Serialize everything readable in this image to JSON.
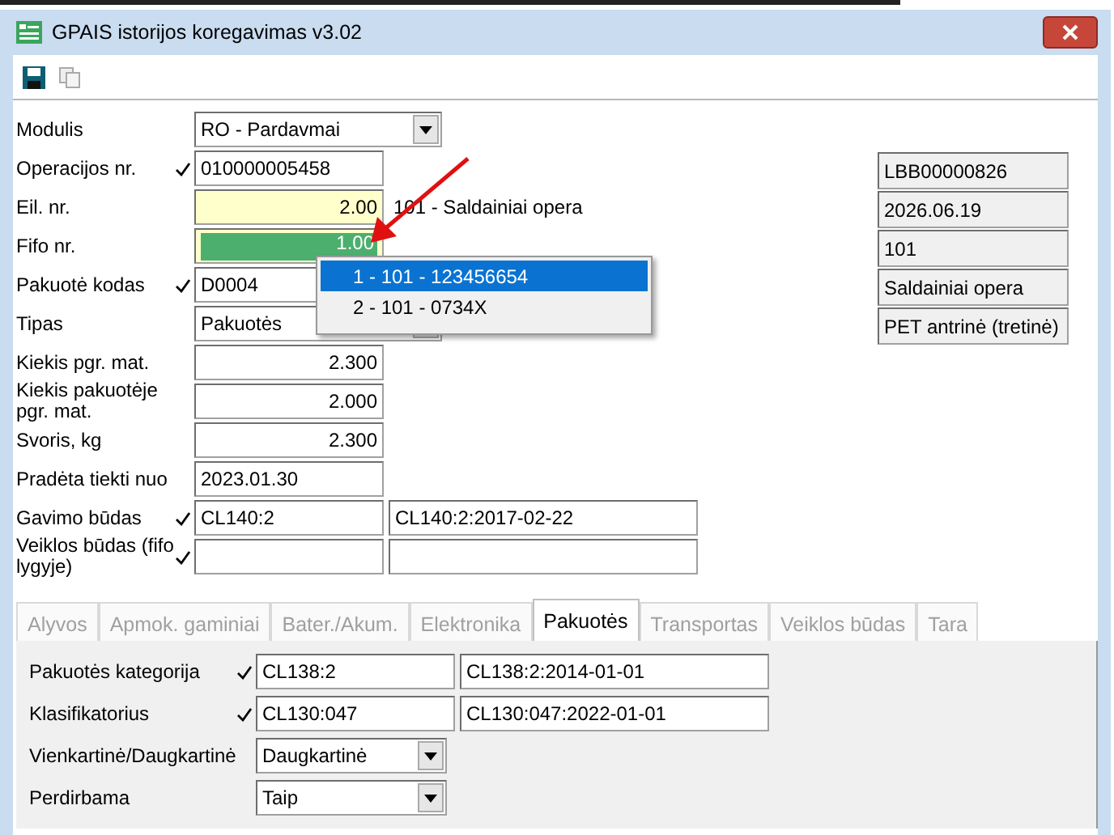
{
  "window": {
    "title": "GPAIS istorijos koregavimas v3.02"
  },
  "form": [
    {
      "label": "Modulis",
      "kind": "select",
      "checked": false,
      "value": "RO - Pardavmai"
    },
    {
      "label": "Operacijos nr.",
      "kind": "text",
      "checked": true,
      "value": "010000005458"
    },
    {
      "label": "Eil. nr.",
      "kind": "number",
      "checked": false,
      "value": "2.00",
      "highlighted": true,
      "note": "101 - Saldainiai opera"
    },
    {
      "label": "Fifo nr.",
      "kind": "number",
      "checked": false,
      "value": "1.00",
      "highlighted": true,
      "value_selected": true
    },
    {
      "label": "Pakuotė kodas",
      "kind": "text",
      "checked": true,
      "value": "D0004"
    },
    {
      "label": "Tipas",
      "kind": "select",
      "checked": false,
      "value": "Pakuotės"
    },
    {
      "label": "Kiekis pgr. mat.",
      "kind": "number",
      "checked": false,
      "value": "2.300"
    },
    {
      "label": "Kiekis pakuotėje pgr. mat.",
      "kind": "number",
      "checked": false,
      "value": "2.000"
    },
    {
      "label": "Svoris, kg",
      "kind": "number",
      "checked": false,
      "value": "2.300"
    },
    {
      "label": "Pradėta tiekti nuo",
      "kind": "text",
      "checked": false,
      "value": "2023.01.30"
    },
    {
      "label": "Gavimo būdas",
      "kind": "pair",
      "checked": true,
      "value": "CL140:2",
      "extra": "CL140:2:2017-02-22"
    },
    {
      "label": "Veiklos būdas (fifo lygyje)",
      "kind": "pair",
      "checked": true
    }
  ],
  "info": [
    "LBB00000826",
    "2026.06.19",
    "101",
    "Saldainiai opera",
    "PET antrinė (tretinė)"
  ],
  "dropdown": [
    {
      "label": "1 - 101 - 123456654",
      "selected": true
    },
    {
      "label": "2 - 101 - 0734X",
      "selected": false
    }
  ],
  "tabs": [
    {
      "label": "Alyvos",
      "selected": false
    },
    {
      "label": "Apmok. gaminiai",
      "selected": false
    },
    {
      "label": "Bater./Akum.",
      "selected": false
    },
    {
      "label": "Elektronika",
      "selected": false
    },
    {
      "label": "Pakuotės",
      "selected": true
    },
    {
      "label": "Transportas",
      "selected": false
    },
    {
      "label": "Veiklos būdas",
      "selected": false
    },
    {
      "label": "Tara",
      "selected": false
    }
  ],
  "tab_form": [
    {
      "label": "Pakuotės kategorija",
      "kind": "pair",
      "checked": true,
      "value": "CL138:2",
      "extra": "CL138:2:2014-01-01"
    },
    {
      "label": "Klasifikatorius",
      "kind": "pair",
      "checked": true,
      "value": "CL130:047",
      "extra": "CL130:047:2022-01-01"
    },
    {
      "label": "Vienkartinė/Daugkartinė",
      "kind": "select",
      "checked": false,
      "value": "Daugkartinė"
    },
    {
      "label": "Perdirbama",
      "kind": "select",
      "checked": false,
      "value": "Taip"
    }
  ]
}
